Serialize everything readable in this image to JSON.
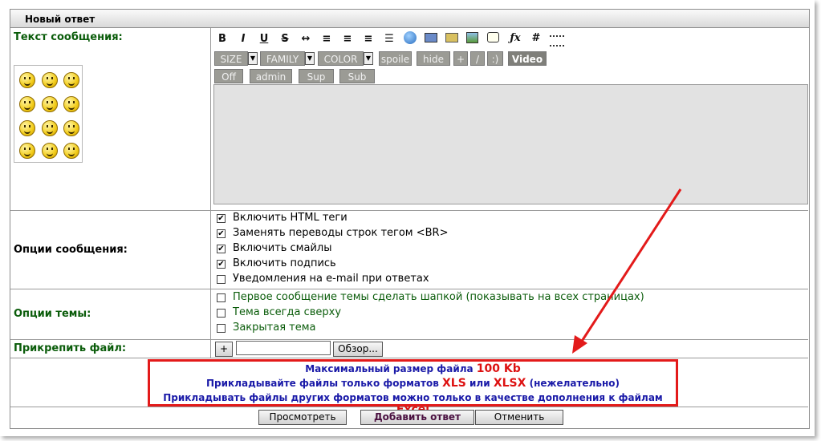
{
  "header": {
    "title": "Новый ответ"
  },
  "message": {
    "label": "Текст сообщения:",
    "smileys": [
      "angry-smiley",
      "laugh-smiley",
      "cool-smiley",
      "shocked-smiley",
      "wink-smiley",
      "smile-smiley",
      "sad-smiley",
      "happy-smiley",
      "surprised-smiley",
      "tongue-smiley",
      "dizzy-smiley",
      "smirk-smiley"
    ]
  },
  "toolbar": {
    "format_icons": [
      "B",
      "I",
      "U",
      "S",
      "↔",
      "≡",
      "≡",
      "≡",
      "☰"
    ],
    "size_label": "SIZE",
    "family_label": "FAMILY",
    "color_label": "COLOR",
    "spoiler_label": "spoile",
    "hide_label": "hide",
    "plus_label": "+",
    "slash_label": "/",
    "smile_label": ":)",
    "video_label": "Video",
    "off_label": "Off",
    "admin_label": "admin",
    "sup_label": "Sup",
    "sub_label": "Sub"
  },
  "message_options": {
    "label": "Опции сообщения:",
    "items": [
      {
        "label": "Включить HTML теги",
        "checked": true
      },
      {
        "label": "Заменять переводы строк тегом <BR>",
        "checked": true
      },
      {
        "label": "Включить смайлы",
        "checked": true
      },
      {
        "label": "Включить подпись",
        "checked": true
      },
      {
        "label": "Уведомления на e-mail при ответах",
        "checked": false
      }
    ]
  },
  "topic_options": {
    "label": "Опции темы:",
    "items": [
      {
        "label": "Первое сообщение темы сделать шапкой (показывать на всех страницах)",
        "checked": false
      },
      {
        "label": "Тема всегда сверху",
        "checked": false
      },
      {
        "label": "Закрытая тема",
        "checked": false
      }
    ]
  },
  "attach": {
    "label": "Прикрепить файл:",
    "plus_label": "+",
    "file_value": "",
    "browse_label": "Обзор..."
  },
  "info": {
    "line1_text": "Максимальный размер файла",
    "line1_value": "100 Kb",
    "line2_a": "Прикладывайте файлы только форматов",
    "line2_xls": "XLS",
    "line2_or": "или",
    "line2_xlsx": "XLSX",
    "line2_b": "(нежелательно)",
    "line3_text": "Прикладывать файлы других форматов можно только в качестве дополнения к файлам",
    "line3_value": "Excel"
  },
  "actions": {
    "preview_label": "Просмотреть",
    "submit_label": "Добавить ответ",
    "cancel_label": "Отменить"
  },
  "colors": {
    "accent_red": "#e31a1a",
    "info_blue": "#1a1aa8",
    "label_green": "#0a5c0a"
  }
}
